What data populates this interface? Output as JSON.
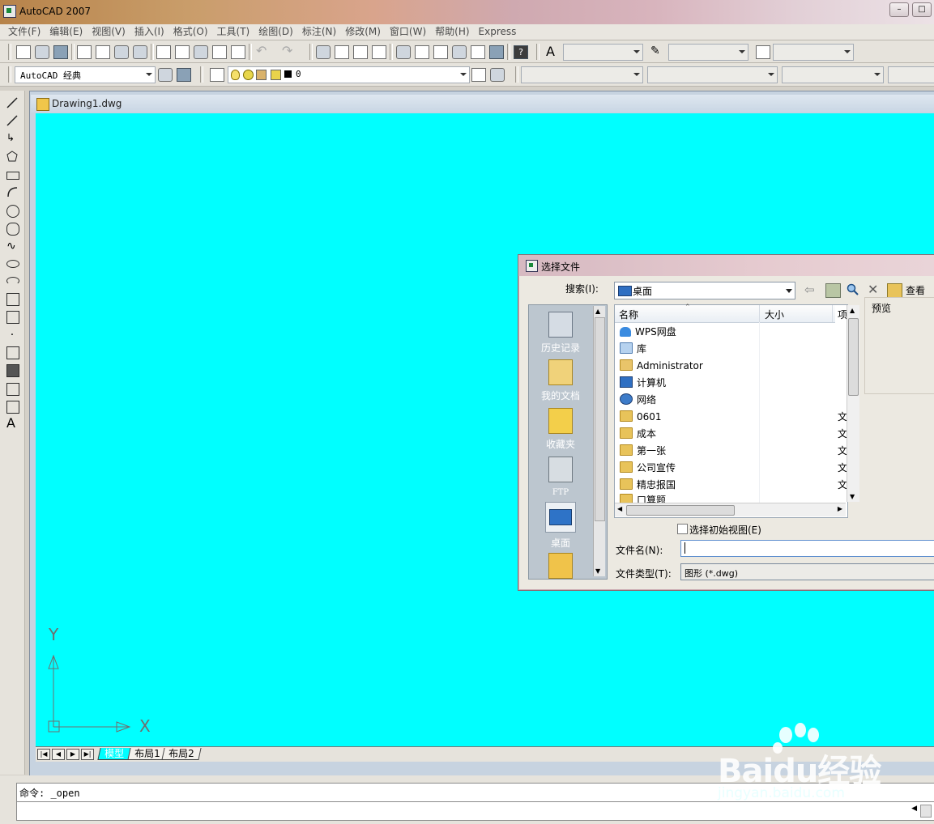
{
  "window": {
    "title": "AutoCAD 2007"
  },
  "menu": [
    "文件(F)",
    "编辑(E)",
    "视图(V)",
    "插入(I)",
    "格式(O)",
    "工具(T)",
    "绘图(D)",
    "标注(N)",
    "修改(M)",
    "窗口(W)",
    "帮助(H)",
    "Express"
  ],
  "toolbar2": {
    "workspace": "AutoCAD 经典",
    "layer": "0"
  },
  "document": {
    "title": "Drawing1.dwg"
  },
  "ucs": {
    "x_label": "X",
    "y_label": "Y"
  },
  "layout_tabs": [
    "模型",
    "布局1",
    "布局2"
  ],
  "command": {
    "history": "命令: _open"
  },
  "dialog": {
    "title": "选择文件",
    "search_label": "搜索(I):",
    "location": "桌面",
    "view_label": "查看(V",
    "preview_label": "预览",
    "places": [
      "历史记录",
      "我的文档",
      "收藏夹",
      "FTP",
      "桌面"
    ],
    "columns": {
      "name": "名称",
      "size": "大小",
      "type": "项"
    },
    "files": [
      {
        "name": "WPS网盘",
        "type": ""
      },
      {
        "name": "库",
        "type": ""
      },
      {
        "name": "Administrator",
        "type": ""
      },
      {
        "name": "计算机",
        "type": ""
      },
      {
        "name": "网络",
        "type": ""
      },
      {
        "name": "0601",
        "type": "文"
      },
      {
        "name": "成本",
        "type": "文"
      },
      {
        "name": "第一张",
        "type": "文"
      },
      {
        "name": "公司宣传",
        "type": "文"
      },
      {
        "name": "精忠报国",
        "type": "文"
      },
      {
        "name": "口算题",
        "type": "文"
      }
    ],
    "initial_view_label": "选择初始视图(E)",
    "filename_label": "文件名(N):",
    "filename_value": "",
    "filetype_label": "文件类型(T):",
    "filetype_value": "图形 (*.dwg)"
  },
  "watermark": {
    "brand": "Baidu经验",
    "url": "jingyan.baidu.com"
  },
  "colors": {
    "canvas": "#00FFFF",
    "title_gradient_start": "#b7834a",
    "dialog_title": "#e6cbd0"
  }
}
